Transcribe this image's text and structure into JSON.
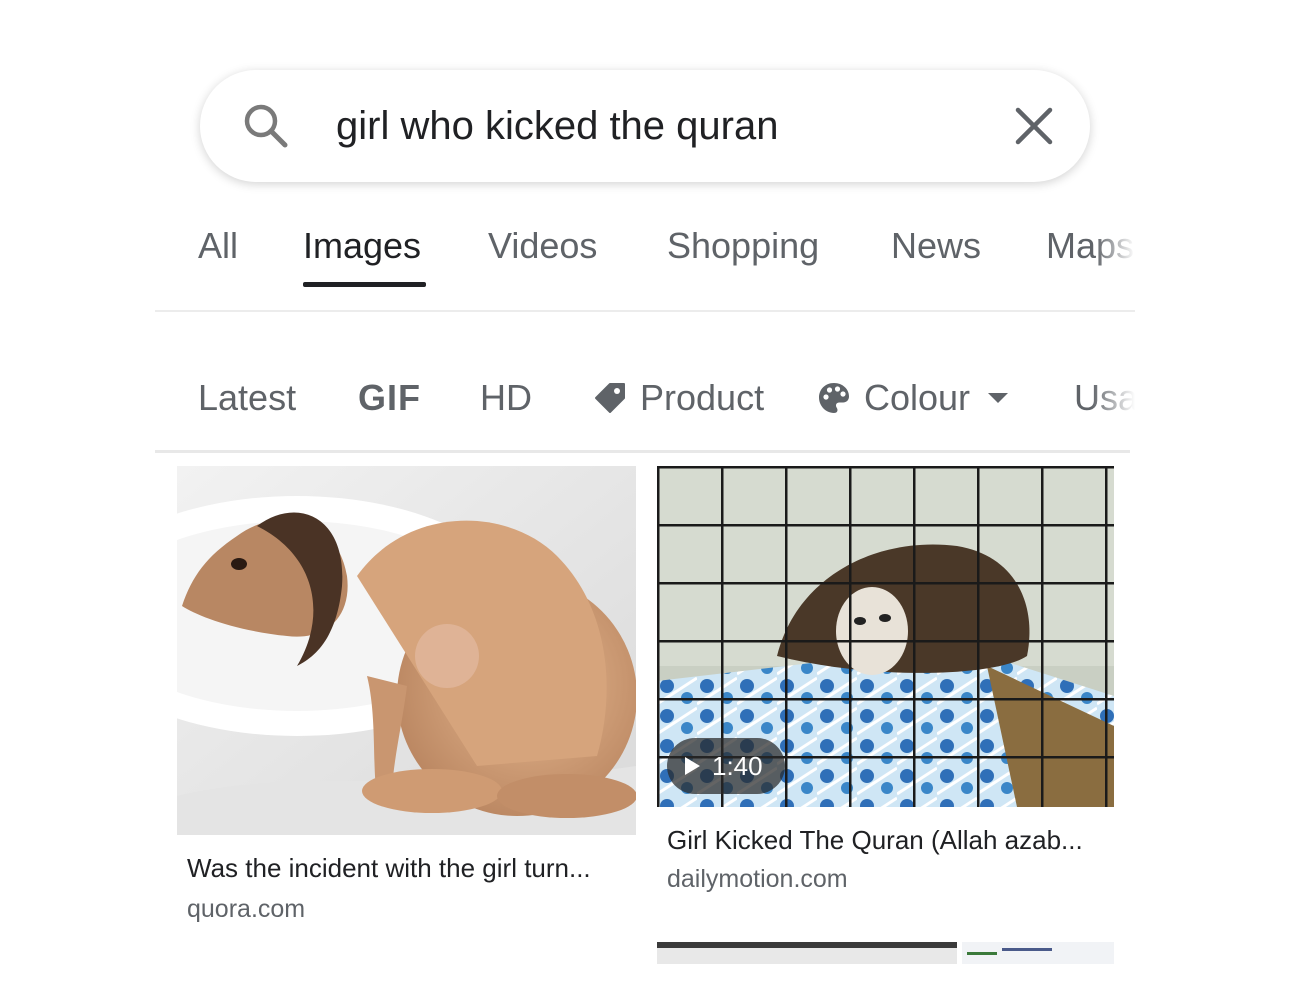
{
  "search": {
    "query": "girl who kicked the quran"
  },
  "tabs": [
    {
      "label": "All",
      "active": false
    },
    {
      "label": "Images",
      "active": true
    },
    {
      "label": "Videos",
      "active": false
    },
    {
      "label": "Shopping",
      "active": false
    },
    {
      "label": "News",
      "active": false
    },
    {
      "label": "Maps",
      "active": false
    }
  ],
  "chips": [
    {
      "label": "Latest"
    },
    {
      "label": "GIF"
    },
    {
      "label": "HD"
    },
    {
      "label": "Product",
      "icon": "tag-icon"
    },
    {
      "label": "Colour",
      "icon": "palette-icon",
      "dropdown": true
    },
    {
      "label": "Usa"
    }
  ],
  "results": [
    {
      "title": "Was the incident with the girl turn...",
      "source": "quora.com"
    },
    {
      "title": "Girl Kicked The Quran (Allah azab...",
      "source": "dailymotion.com",
      "duration": "1:40"
    }
  ],
  "colors": {
    "active_text": "#202124",
    "inactive_text": "#5f6368",
    "divider": "#ececec"
  }
}
